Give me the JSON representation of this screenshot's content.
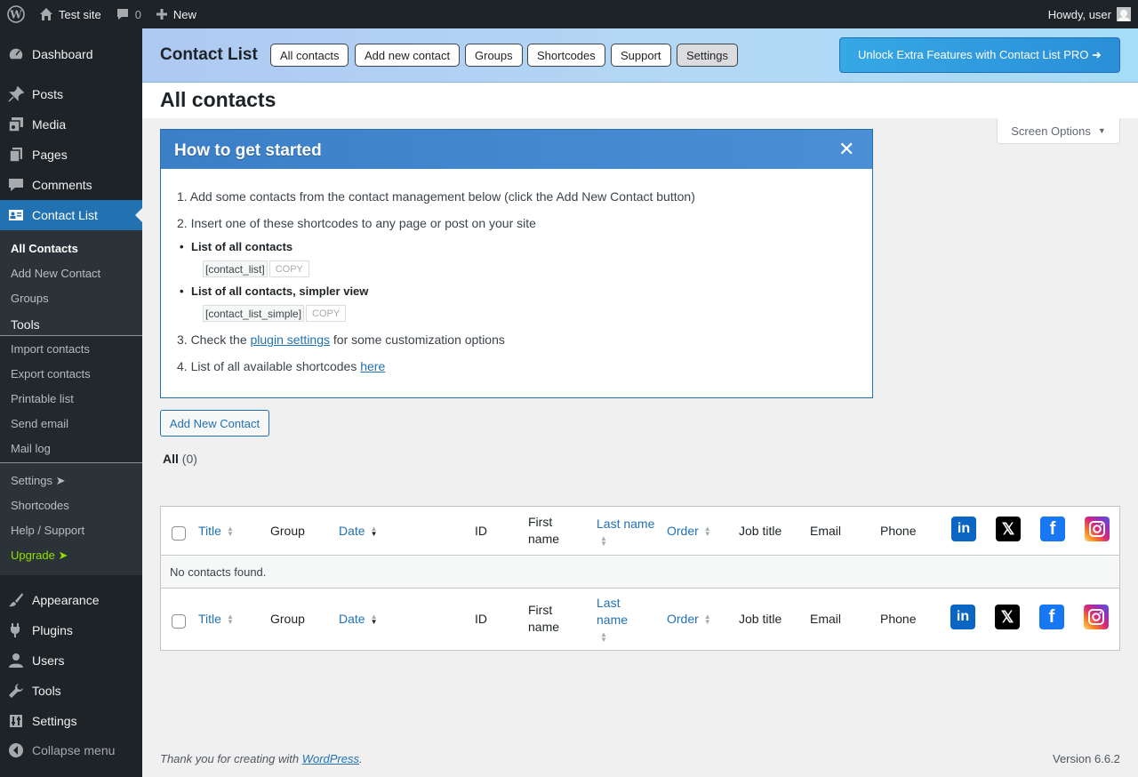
{
  "adminbar": {
    "site_name": "Test site",
    "comments_count": "0",
    "new_label": "New",
    "howdy": "Howdy, user"
  },
  "sidebar": {
    "items": [
      {
        "label": "Dashboard",
        "icon": "dashboard-icon"
      },
      {
        "label": "Posts",
        "icon": "pin-icon"
      },
      {
        "label": "Media",
        "icon": "media-icon"
      },
      {
        "label": "Pages",
        "icon": "pages-icon"
      },
      {
        "label": "Comments",
        "icon": "comment-icon"
      },
      {
        "label": "Contact List",
        "icon": "id-card-icon"
      }
    ],
    "submenu": {
      "all_contacts": "All Contacts",
      "add_new_contact": "Add New Contact",
      "groups": "Groups",
      "tools": "Tools",
      "import": "Import contacts",
      "export": "Export contacts",
      "printable": "Printable list",
      "send_email": "Send email",
      "mail_log": "Mail log",
      "settings": "Settings",
      "shortcodes": "Shortcodes",
      "help": "Help / Support",
      "upgrade": "Upgrade"
    },
    "bottom_items": [
      {
        "label": "Appearance",
        "icon": "brush-icon"
      },
      {
        "label": "Plugins",
        "icon": "plugin-icon"
      },
      {
        "label": "Users",
        "icon": "users-icon"
      },
      {
        "label": "Tools",
        "icon": "wrench-icon"
      },
      {
        "label": "Settings",
        "icon": "settings-icon"
      }
    ],
    "collapse": "Collapse menu"
  },
  "plugin_header": {
    "title": "Contact List",
    "tabs": [
      "All contacts",
      "Add new contact",
      "Groups",
      "Shortcodes",
      "Support",
      "Settings"
    ],
    "active_tab": "Settings",
    "pro_button": "Unlock Extra Features with Contact List PRO ➜"
  },
  "page": {
    "title": "All contacts",
    "screen_options": "Screen Options"
  },
  "infobox": {
    "title": "How to get started",
    "step1": "1. Add some contacts from the contact management below (click the Add New Contact button)",
    "step2": "2. Insert one of these shortcodes to any page or post on your site",
    "bullet1": "List of all contacts",
    "code1": "[contact_list]",
    "bullet2": "List of all contacts, simpler view",
    "code2": "[contact_list_simple]",
    "copy": "COPY",
    "step3_pre": "3. Check the ",
    "step3_link": "plugin settings",
    "step3_post": " for some customization options",
    "step4_pre": "4. List of all available shortcodes ",
    "step4_link": "here"
  },
  "add_button": "Add New Contact",
  "filter": {
    "label": "All",
    "count": "(0)"
  },
  "table": {
    "columns": {
      "title": "Title",
      "group": "Group",
      "date": "Date",
      "id": "ID",
      "first_name_1": "First",
      "first_name_2": "name",
      "last_name": "Last name",
      "last_name_1": "Last",
      "last_name_2": "name",
      "order": "Order",
      "job_title": "Job title",
      "email": "Email",
      "phone": "Phone"
    },
    "empty": "No contacts found."
  },
  "footer": {
    "thanks_pre": "Thank you for creating with ",
    "thanks_link": "WordPress",
    "thanks_post": ".",
    "version": "Version 6.6.2"
  },
  "colors": {
    "sidebar_bg": "#1d2327",
    "accent": "#2271b1",
    "upgrade": "#8ee000"
  }
}
